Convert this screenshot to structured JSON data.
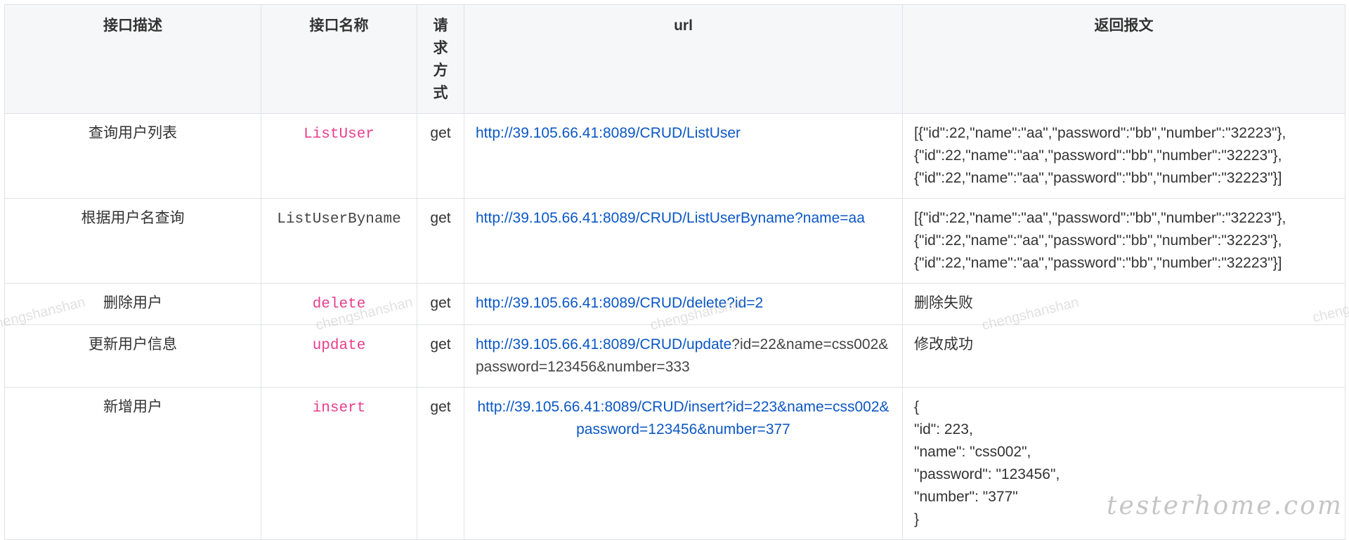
{
  "table": {
    "headers": {
      "desc": "接口描述",
      "name": "接口名称",
      "method": "请求方式",
      "url": "url",
      "response": "返回报文"
    },
    "rows": [
      {
        "desc": "查询用户列表",
        "name": "ListUser",
        "method": "get",
        "url": "http://39.105.66.41:8089/CRUD/ListUser",
        "response": [
          "[{\"id\":22,\"name\":\"aa\",\"password\":\"bb\",\"number\":\"32223\"},",
          "{\"id\":22,\"name\":\"aa\",\"password\":\"bb\",\"number\":\"32223\"},",
          "{\"id\":22,\"name\":\"aa\",\"password\":\"bb\",\"number\":\"32223\"}]"
        ]
      },
      {
        "desc": "根据用户名查询",
        "name": "ListUserByname",
        "method": "get",
        "url": "http://39.105.66.41:8089/CRUD/ListUserByname?name=aa",
        "response": [
          "[{\"id\":22,\"name\":\"aa\",\"password\":\"bb\",\"number\":\"32223\"},",
          "{\"id\":22,\"name\":\"aa\",\"password\":\"bb\",\"number\":\"32223\"},",
          "{\"id\":22,\"name\":\"aa\",\"password\":\"bb\",\"number\":\"32223\"}]"
        ]
      },
      {
        "desc": "删除用户",
        "name": "delete",
        "method": "get",
        "url": "http://39.105.66.41:8089/CRUD/delete?id=2",
        "response": [
          "删除失败"
        ]
      },
      {
        "desc": "更新用户信息",
        "name": "update",
        "method": "get",
        "url_link": "http://39.105.66.41:8089/CRUD/update",
        "url_rest": "?id=22&name=css002&password=123456&number=333",
        "response": [
          "修改成功"
        ]
      },
      {
        "desc": "新增用户",
        "name": "insert",
        "method": "get",
        "url": "http://39.105.66.41:8089/CRUD/insert?id=223&name=css002&password=123456&number=377",
        "response": [
          "{",
          "\"id\": 223,",
          "\"name\": \"css002\",",
          "\"password\": \"123456\",",
          "\"number\": \"377\"",
          "}"
        ]
      }
    ]
  },
  "watermarks": {
    "text": "chengshanshan",
    "site": "testerhome.com"
  },
  "colors": {
    "link": "#0b57c5",
    "code_pink": "#e83e8c",
    "header_bg": "#f6f7f8",
    "border": "#dfe2e5"
  }
}
